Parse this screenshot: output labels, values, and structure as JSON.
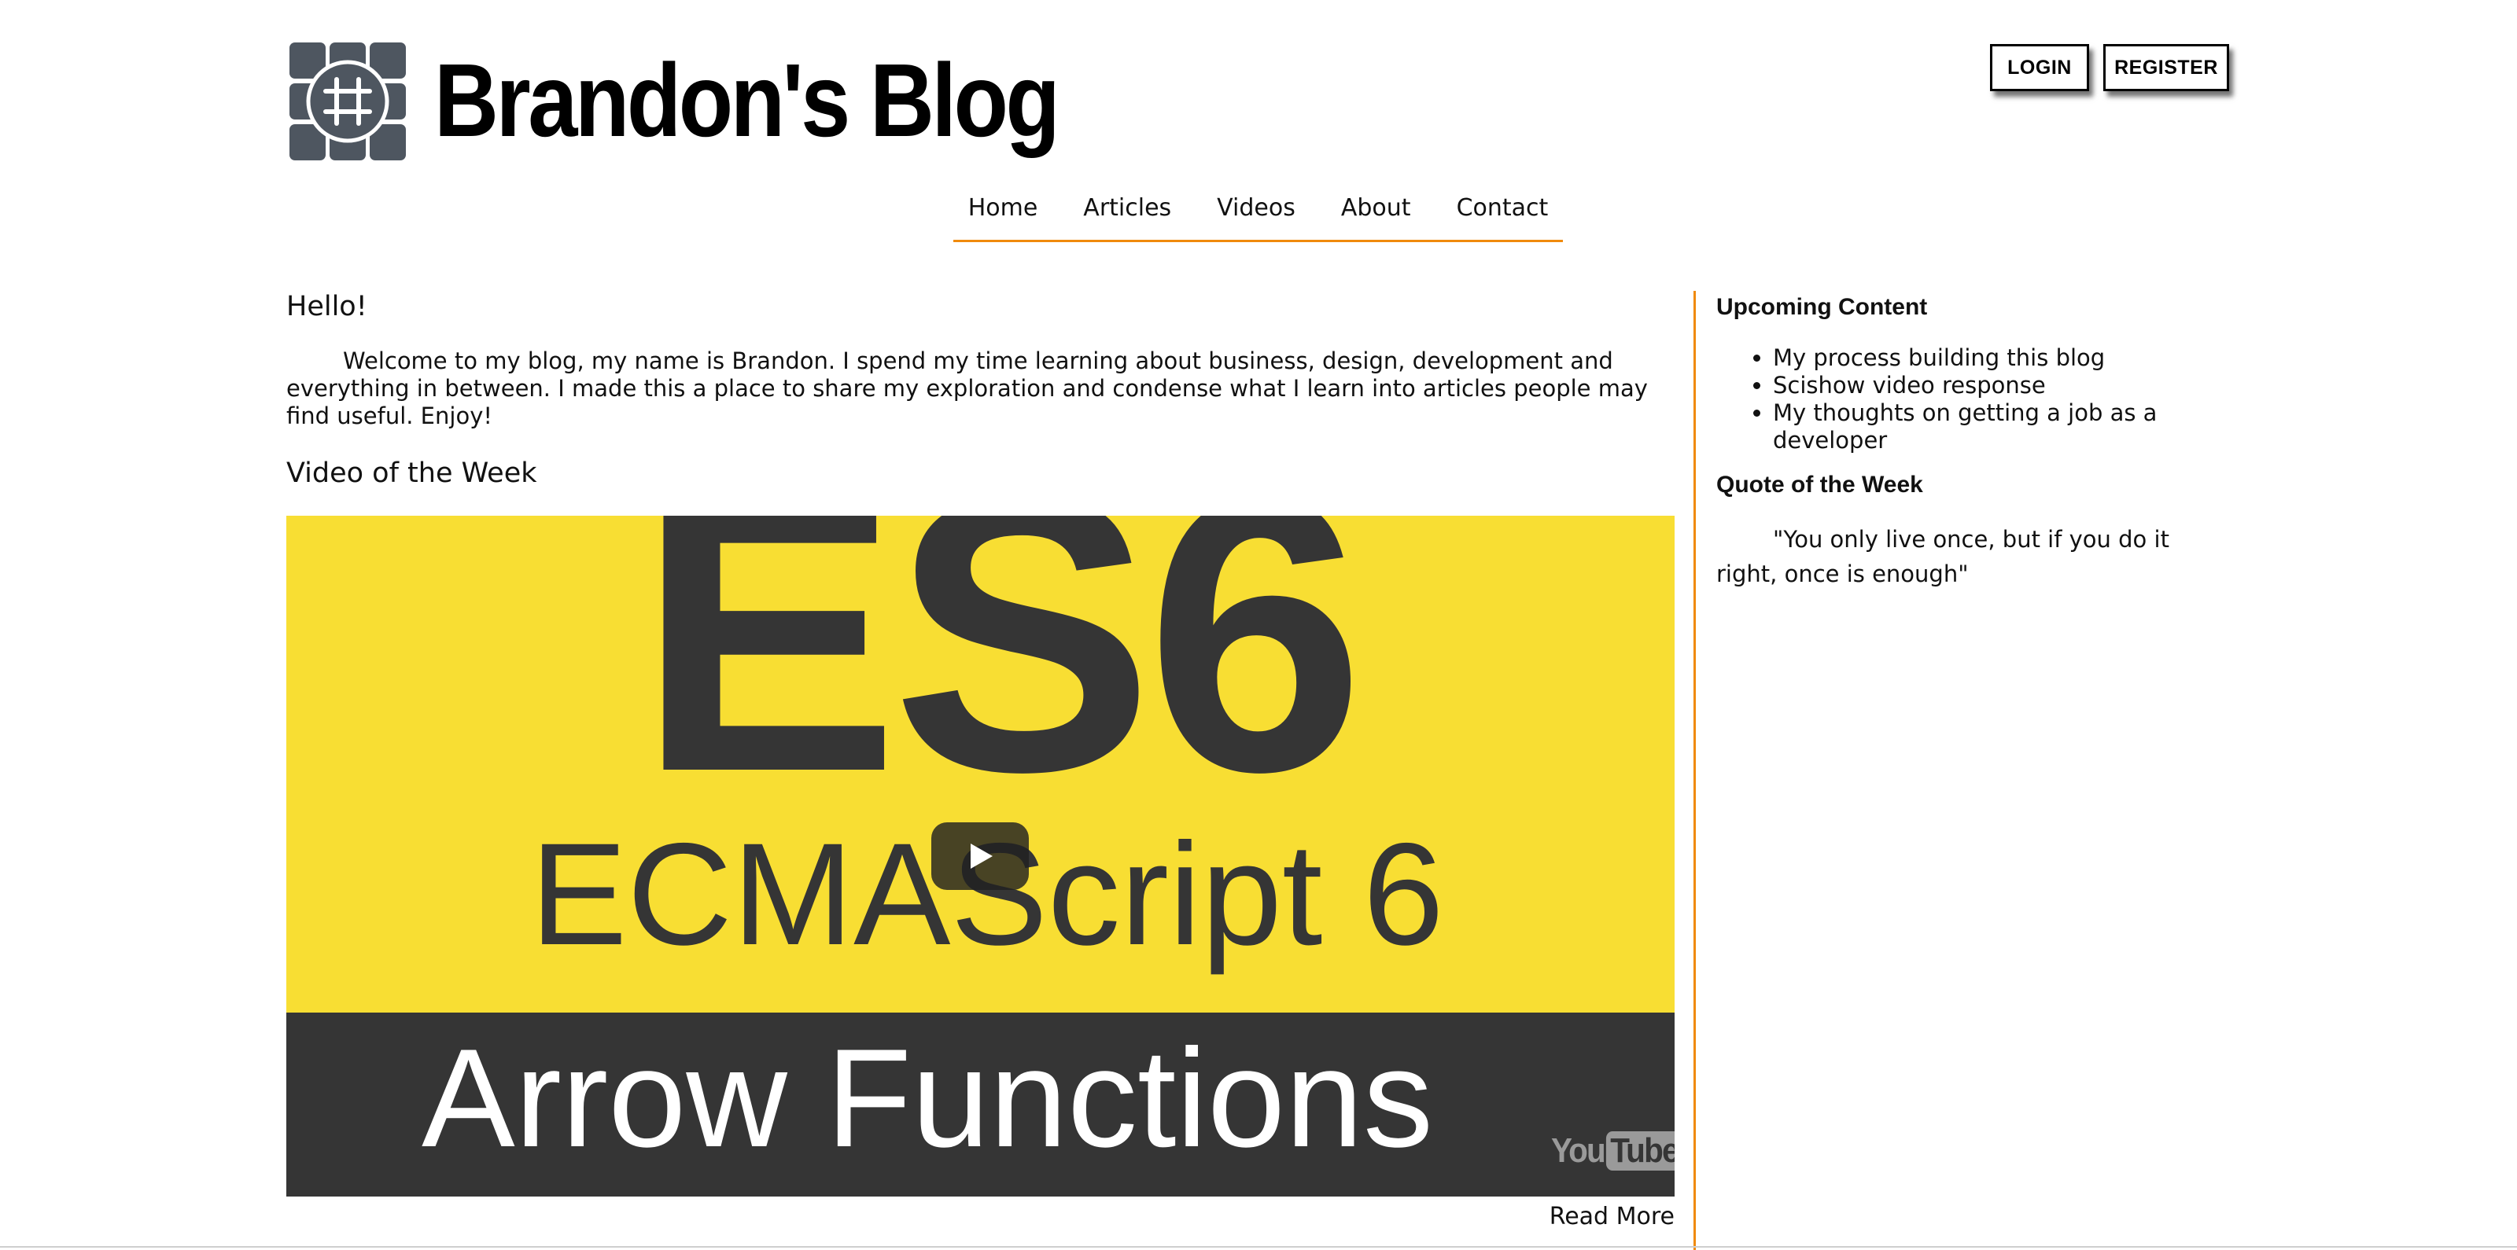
{
  "header": {
    "site_title": "Brandon's Blog",
    "logo_icon": "hashtag-grid-logo",
    "login_label": "LOGIN",
    "register_label": "REGISTER"
  },
  "nav": {
    "items": [
      {
        "label": "Home"
      },
      {
        "label": "Articles"
      },
      {
        "label": "Videos"
      },
      {
        "label": "About"
      },
      {
        "label": "Contact"
      }
    ]
  },
  "main": {
    "hello_heading": "Hello!",
    "intro_text": "Welcome to my blog, my name is Brandon. I spend my time learning about business, design, development and everything in between. I made this a place to share my exploration and condense what I learn into articles people may find useful. Enjoy!",
    "video_heading": "Video of the Week",
    "video": {
      "big_text": "ES6",
      "subtitle": "ECMAScript 6",
      "band_text": "Arrow Functions",
      "badge_you": "You",
      "badge_tube": "Tube"
    },
    "read_more": "Read More"
  },
  "sidebar": {
    "upcoming_heading": "Upcoming Content",
    "upcoming_items": [
      "My process building this blog",
      "Scishow video response",
      "My thoughts on getting a job as a developer"
    ],
    "quote_heading": "Quote of the Week",
    "quote_text": "\"You only live once, but if you do it right, once is enough\""
  },
  "colors": {
    "accent": "#f08a0c",
    "logo": "#4e5660",
    "video_yellow": "#f8de33",
    "video_dark": "#353535"
  }
}
